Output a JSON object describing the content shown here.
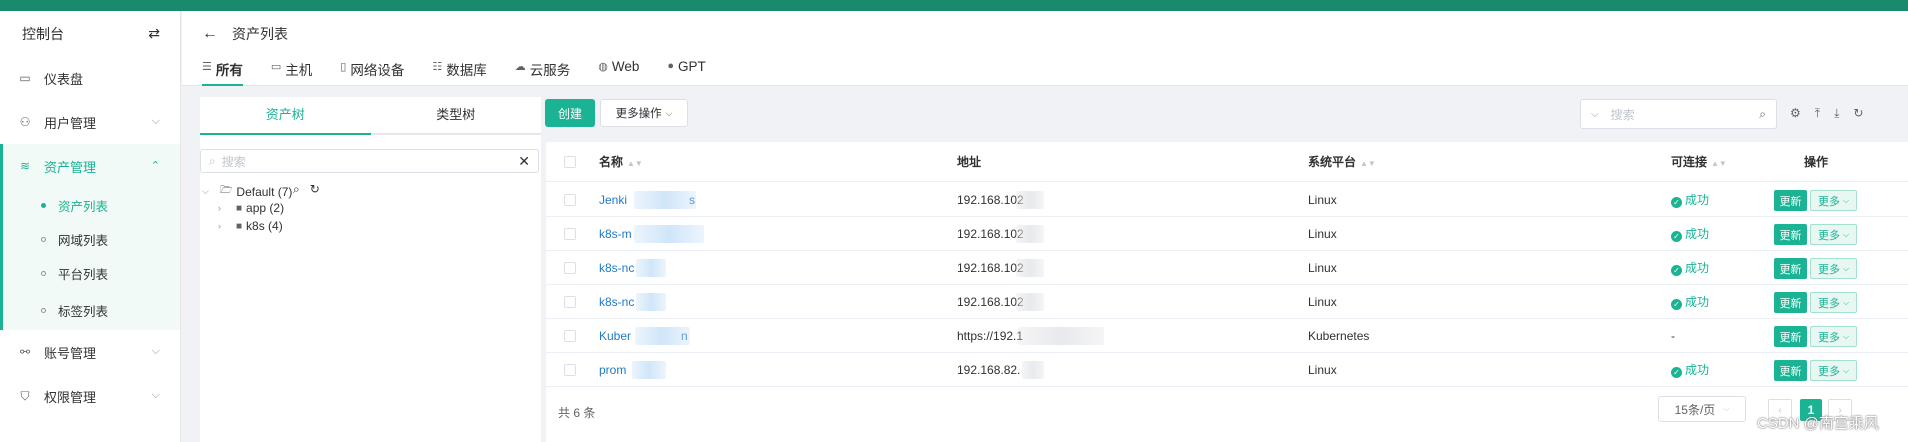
{
  "colors": {
    "topbar": "#1a8a6e",
    "accent": "#1ab394",
    "link": "#1f7ac9"
  },
  "sidebar": {
    "title": "控制台",
    "toggle_icon": "swap-icon",
    "items": [
      {
        "label": "仪表盘",
        "icon": "dashboard-icon"
      },
      {
        "label": "用户管理",
        "icon": "users-icon"
      },
      {
        "label": "资产管理",
        "icon": "layers-icon"
      },
      {
        "label": "账号管理",
        "icon": "accounts-icon"
      },
      {
        "label": "权限管理",
        "icon": "shield-icon"
      }
    ],
    "sub_items": [
      "资产列表",
      "网域列表",
      "平台列表",
      "标签列表"
    ]
  },
  "header": {
    "title": "资产列表",
    "tabs": [
      {
        "label": "所有",
        "icon": "list-icon"
      },
      {
        "label": "主机",
        "icon": "laptop-icon"
      },
      {
        "label": "网络设备",
        "icon": "device-icon"
      },
      {
        "label": "数据库",
        "icon": "database-icon"
      },
      {
        "label": "云服务",
        "icon": "cloud-icon"
      },
      {
        "label": "Web",
        "icon": "globe-icon"
      },
      {
        "label": "GPT",
        "icon": "chat-icon"
      }
    ]
  },
  "tree": {
    "tabs": [
      "资产树",
      "类型树"
    ],
    "search_placeholder": "搜索",
    "root": "Default (7)",
    "children": [
      "app (2)",
      "k8s (4)"
    ]
  },
  "toolbar": {
    "create_label": "创建",
    "more_label": "更多操作",
    "search_placeholder": "搜索"
  },
  "table": {
    "columns": [
      "名称",
      "地址",
      "系统平台",
      "可连接",
      "操作"
    ],
    "rows": [
      {
        "name_a": "Jenki",
        "name_b": "s",
        "address": "192.168.102",
        "platform": "Linux",
        "status": "成功"
      },
      {
        "name_a": "k8s-m",
        "name_b": "",
        "address": "192.168.102",
        "platform": "Linux",
        "status": "成功"
      },
      {
        "name_a": "k8s-nc",
        "name_b": "",
        "address": "192.168.102",
        "platform": "Linux",
        "status": "成功"
      },
      {
        "name_a": "k8s-nc",
        "name_b": "",
        "address": "192.168.102",
        "platform": "Linux",
        "status": "成功"
      },
      {
        "name_a": "Kuber",
        "name_b": "n",
        "address": "https://192.1",
        "platform": "Kubernetes",
        "status": "-"
      },
      {
        "name_a": "prom",
        "name_b": "",
        "address": "192.168.82.",
        "platform": "Linux",
        "status": "成功"
      }
    ],
    "update_label": "更新",
    "more_label": "更多"
  },
  "pagination": {
    "total": "共 6 条",
    "page_size": "15条/页",
    "current": "1"
  },
  "watermark": "CSDN @南宫乘风"
}
